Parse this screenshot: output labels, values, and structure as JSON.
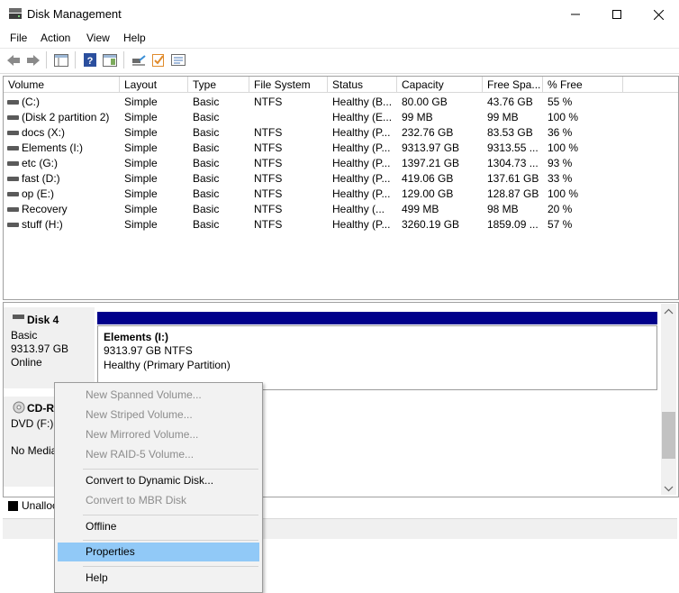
{
  "window": {
    "title": "Disk Management"
  },
  "menu": [
    "File",
    "Action",
    "View",
    "Help"
  ],
  "toolbar": {
    "icons": [
      "back-arrow-icon",
      "forward-arrow-icon",
      "show-hide-console-tree-icon",
      "help-icon",
      "action-pane-icon",
      "connect-icon",
      "checklist-icon",
      "properties-list-icon"
    ]
  },
  "volume_table": {
    "columns": [
      "Volume",
      "Layout",
      "Type",
      "File System",
      "Status",
      "Capacity",
      "Free Spa...",
      "% Free"
    ],
    "rows": [
      [
        "(C:)",
        "Simple",
        "Basic",
        "NTFS",
        "Healthy (B...",
        "80.00 GB",
        "43.76 GB",
        "55 %"
      ],
      [
        "(Disk 2 partition 2)",
        "Simple",
        "Basic",
        "",
        "Healthy (E...",
        "99 MB",
        "99 MB",
        "100 %"
      ],
      [
        "docs (X:)",
        "Simple",
        "Basic",
        "NTFS",
        "Healthy (P...",
        "232.76 GB",
        "83.53 GB",
        "36 %"
      ],
      [
        "Elements (I:)",
        "Simple",
        "Basic",
        "NTFS",
        "Healthy (P...",
        "9313.97 GB",
        "9313.55 ...",
        "100 %"
      ],
      [
        "etc (G:)",
        "Simple",
        "Basic",
        "NTFS",
        "Healthy (P...",
        "1397.21 GB",
        "1304.73 ...",
        "93 %"
      ],
      [
        "fast (D:)",
        "Simple",
        "Basic",
        "NTFS",
        "Healthy (P...",
        "419.06 GB",
        "137.61 GB",
        "33 %"
      ],
      [
        "op (E:)",
        "Simple",
        "Basic",
        "NTFS",
        "Healthy (P...",
        "129.00 GB",
        "128.87 GB",
        "100 %"
      ],
      [
        "Recovery",
        "Simple",
        "Basic",
        "NTFS",
        "Healthy (...",
        "499 MB",
        "98 MB",
        "20 %"
      ],
      [
        "stuff (H:)",
        "Simple",
        "Basic",
        "NTFS",
        "Healthy (P...",
        "3260.19 GB",
        "1859.09 ...",
        "57 %"
      ]
    ]
  },
  "disk4": {
    "name": "Disk 4",
    "type": "Basic",
    "size": "9313.97 GB",
    "state": "Online",
    "partition": {
      "name": "Elements  (I:)",
      "size_fs": "9313.97 GB NTFS",
      "status": "Healthy (Primary Partition)",
      "color": "#00008b"
    }
  },
  "cdrom": {
    "name": "CD-R",
    "drive": "DVD (F:)",
    "media": "No Media"
  },
  "legend": {
    "unallocated": "Unalloc"
  },
  "context_menu": {
    "items": [
      {
        "label": "New Spanned Volume...",
        "enabled": false
      },
      {
        "label": "New Striped Volume...",
        "enabled": false
      },
      {
        "label": "New Mirrored Volume...",
        "enabled": false
      },
      {
        "label": "New RAID-5 Volume...",
        "enabled": false
      },
      {
        "label": "Convert to Dynamic Disk...",
        "enabled": true
      },
      {
        "label": "Convert to MBR Disk",
        "enabled": false
      },
      {
        "label": "Offline",
        "enabled": true
      },
      {
        "label": "Properties",
        "enabled": true,
        "highlighted": true
      },
      {
        "label": "Help",
        "enabled": true
      }
    ]
  },
  "colors": {
    "primary_partition": "#00008b",
    "menu_highlight": "#91c9f7"
  }
}
